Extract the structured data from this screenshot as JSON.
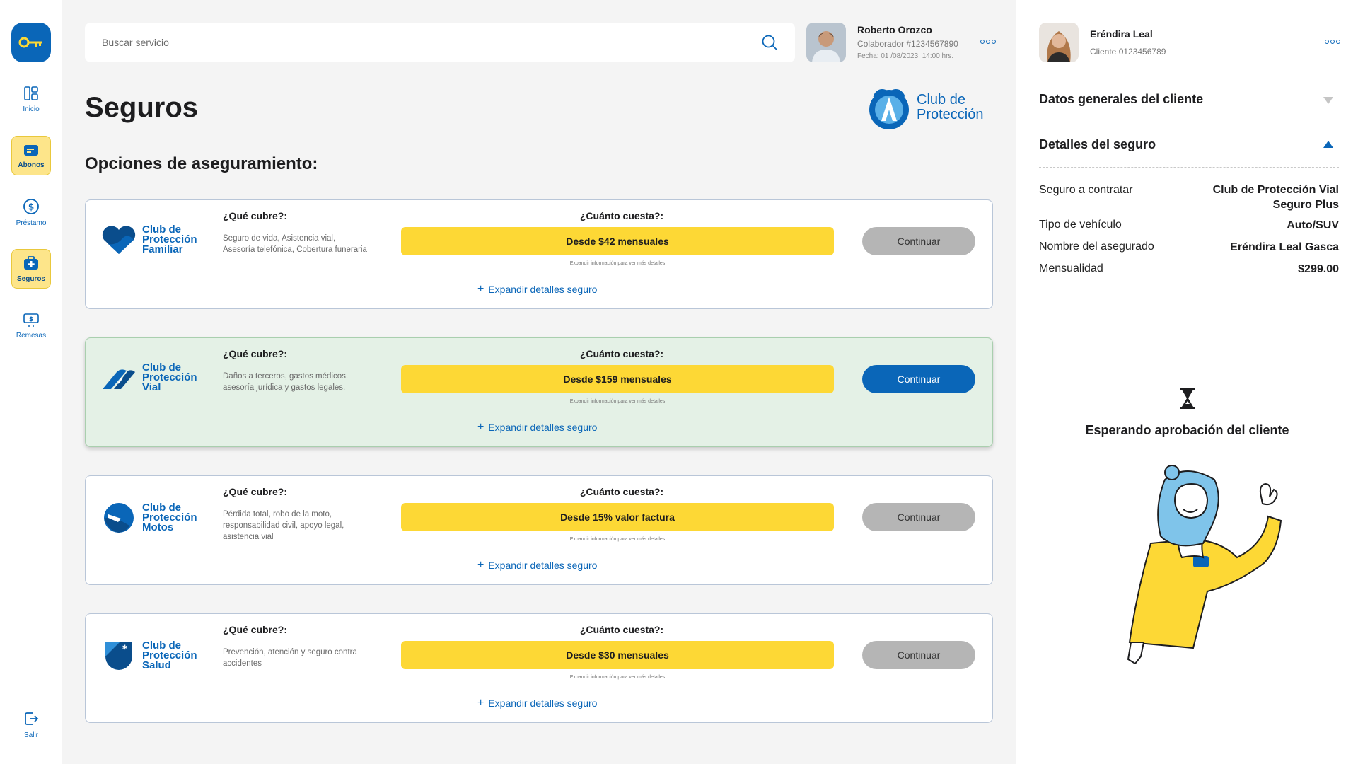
{
  "sidebar": {
    "items": [
      {
        "label": "Inicio"
      },
      {
        "label": "Abonos"
      },
      {
        "label": "Préstamo"
      },
      {
        "label": "Seguros"
      },
      {
        "label": "Remesas"
      }
    ],
    "logout": "Salir"
  },
  "search": {
    "placeholder": "Buscar servicio"
  },
  "user": {
    "name": "Roberto Orozco",
    "collaborator": "Colaborador #1234567890",
    "date": "Fecha: 01 /08/2023, 14:00 hrs."
  },
  "page": {
    "title": "Seguros",
    "section": "Opciones de aseguramiento:",
    "brand_line1": "Club de",
    "brand_line2": "Protección"
  },
  "cards": [
    {
      "name_line1": "Club de",
      "name_line2": "Protección",
      "name_line3": "Familiar",
      "covers_label": "¿Qué cubre?:",
      "covers": "Seguro de vida, Asistencia vial, Asesoría telefónica, Cobertura funeraria",
      "cost_label": "¿Cuánto cuesta?:",
      "price": "Desde $42 mensuales",
      "hint": "Expandir información para ver más detalles",
      "expand": "Expandir detalles seguro",
      "button": "Continuar"
    },
    {
      "name_line1": "Club de",
      "name_line2": "Protección",
      "name_line3": "Vial",
      "covers_label": "¿Qué cubre?:",
      "covers": "Daños a terceros, gastos médicos, asesoría jurídica y gastos legales.",
      "cost_label": "¿Cuánto cuesta?:",
      "price": "Desde $159 mensuales",
      "hint": "Expandir información para ver más detalles",
      "expand": "Expandir detalles seguro",
      "button": "Continuar"
    },
    {
      "name_line1": "Club de",
      "name_line2": "Protección",
      "name_line3": "Motos",
      "covers_label": "¿Qué cubre?:",
      "covers": "Pérdida total, robo de la moto, responsabilidad civil, apoyo legal, asistencia vial",
      "cost_label": "¿Cuánto cuesta?:",
      "price": "Desde 15% valor factura",
      "hint": "Expandir información para ver más detalles",
      "expand": "Expandir detalles seguro",
      "button": "Continuar"
    },
    {
      "name_line1": "Club de",
      "name_line2": "Protección",
      "name_line3": "Salud",
      "covers_label": "¿Qué cubre?:",
      "covers": "Prevención, atención y seguro contra accidentes",
      "cost_label": "¿Cuánto cuesta?:",
      "price": "Desde $30 mensuales",
      "hint": "Expandir información para ver más detalles",
      "expand": "Expandir detalles seguro",
      "button": "Continuar"
    }
  ],
  "client": {
    "name": "Eréndira Leal",
    "id": "Cliente 0123456789",
    "general_title": "Datos generales del cliente",
    "details_title": "Detalles del seguro",
    "details": [
      {
        "label": "Seguro a contratar",
        "value_line1": "Club de Protección Vial",
        "value_line2": "Seguro Plus"
      },
      {
        "label": "Tipo de vehículo",
        "value_line1": "Auto/SUV"
      },
      {
        "label": "Nombre del asegurado",
        "value_line1": "Eréndira Leal Gasca"
      },
      {
        "label": "Mensualidad",
        "value_line1": "$299.00"
      }
    ],
    "waiting": "Esperando aprobación del cliente"
  },
  "colors": {
    "primary": "#0a66b8",
    "accent": "#fdd835",
    "selected_bg": "#e4f1e6"
  }
}
